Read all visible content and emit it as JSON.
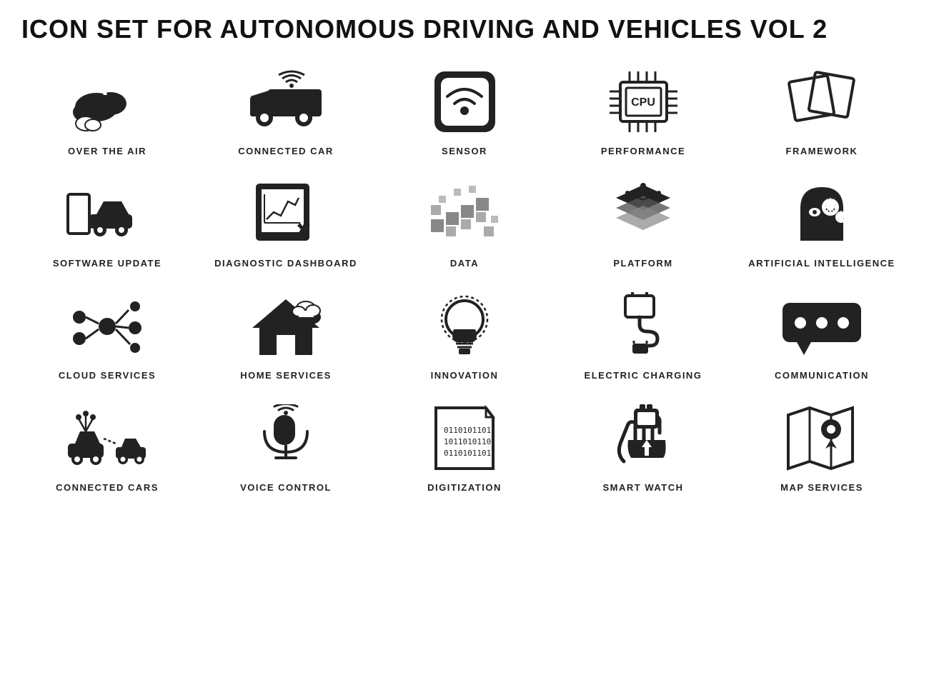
{
  "title": "ICON SET FOR AUTONOMOUS DRIVING AND VEHICLES VOL 2",
  "icons": [
    {
      "label": "OVER THE AIR"
    },
    {
      "label": "CONNECTED CAR"
    },
    {
      "label": "SENSOR"
    },
    {
      "label": "PERFORMANCE"
    },
    {
      "label": "FRAMEWORK"
    },
    {
      "label": "SOFTWARE UPDATE"
    },
    {
      "label": "DIAGNOSTIC DASHBOARD"
    },
    {
      "label": "DATA"
    },
    {
      "label": "PLATFORM"
    },
    {
      "label": "ARTIFICIAL INTELLIGENCE"
    },
    {
      "label": "CLOUD SERVICES"
    },
    {
      "label": "HOME SERVICES"
    },
    {
      "label": "INNOVATION"
    },
    {
      "label": "ELECTRIC CHARGING"
    },
    {
      "label": "COMMUNICATION"
    },
    {
      "label": "CONNECTED CARS"
    },
    {
      "label": "VOICE CONTROL"
    },
    {
      "label": "DIGITIZATION"
    },
    {
      "label": "SMART WATCH"
    },
    {
      "label": "MAP SERVICES"
    }
  ]
}
